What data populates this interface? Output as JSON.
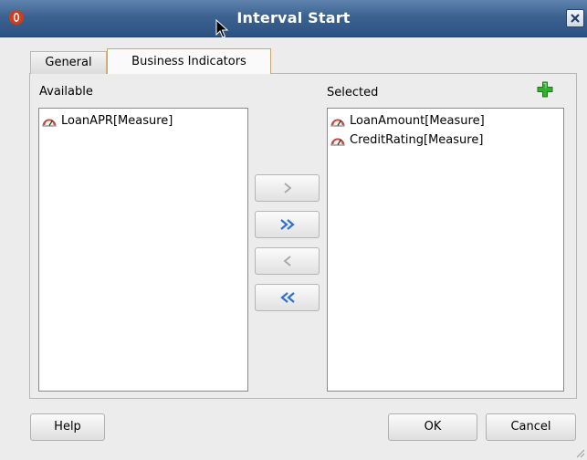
{
  "window": {
    "title": "Interval Start",
    "app_icon": "oracle-o-icon",
    "close_icon": "close-x-icon"
  },
  "tabs": [
    {
      "label": "General",
      "active": false
    },
    {
      "label": "Business Indicators",
      "active": true
    }
  ],
  "available": {
    "label": "Available",
    "items": [
      {
        "label": "LoanAPR[Measure]",
        "icon": "gauge-icon"
      }
    ]
  },
  "selected": {
    "label": "Selected",
    "add_icon": "green-plus-icon",
    "items": [
      {
        "label": "LoanAmount[Measure]",
        "icon": "gauge-icon"
      },
      {
        "label": "CreditRating[Measure]",
        "icon": "gauge-icon"
      }
    ]
  },
  "shuttle_buttons": [
    {
      "icon": "move-right-icon",
      "enabled": false
    },
    {
      "icon": "move-all-right-icon",
      "enabled": true
    },
    {
      "icon": "move-left-icon",
      "enabled": false
    },
    {
      "icon": "move-all-left-icon",
      "enabled": true
    }
  ],
  "footer": {
    "help_label": "Help",
    "ok_label": "OK",
    "cancel_label": "Cancel"
  },
  "colors": {
    "title_bar": "#3b628f",
    "active_tab_border": "#e6a23a",
    "add_icon": "#2fa52a",
    "shuttle_enabled": "#2f6fd0",
    "shuttle_disabled": "#a8a8a8"
  }
}
